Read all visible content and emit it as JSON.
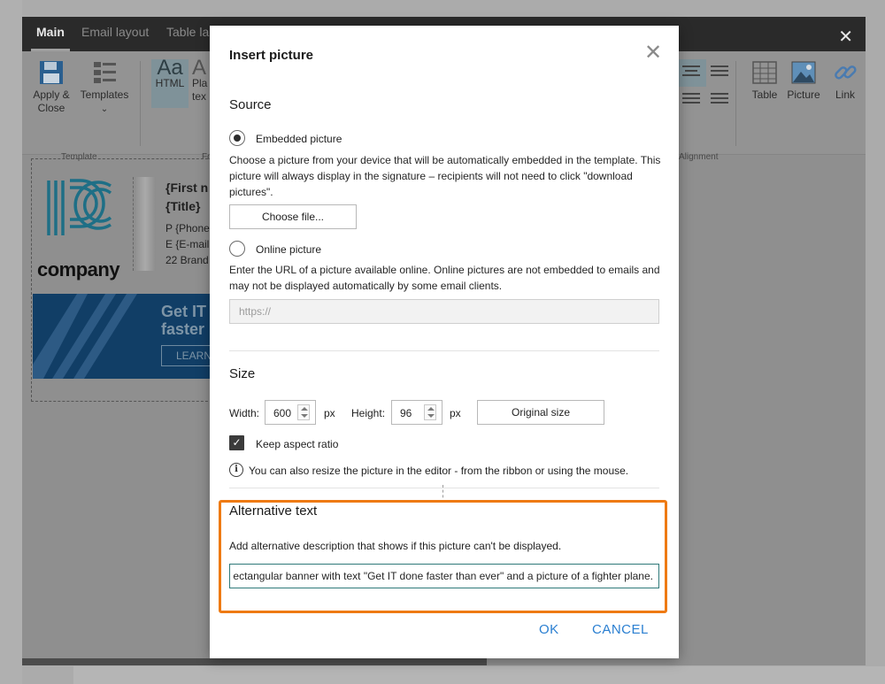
{
  "editor": {
    "tabs": [
      "Main",
      "Email layout",
      "Table la"
    ],
    "close_glyph": "✕",
    "ribbon": {
      "apply_close": "Apply &\nClose",
      "templates": "Templates",
      "templates_caret": "⌄",
      "html": "HTML",
      "plain_text": "Pla\ntex",
      "table": "Table",
      "picture": "Picture",
      "link": "Link",
      "group_template": "Template",
      "group_fo": "Fo",
      "group_alignment": "Alignment"
    },
    "signature": {
      "first_name": "{First n",
      "title": "{Title}",
      "phone": "P {Phone",
      "email": "E {E-mail",
      "address": "22 Brand",
      "company": "company",
      "banner_line1": "Get IT",
      "banner_line2": "faster",
      "banner_button": "LEARN"
    }
  },
  "dialog": {
    "title": "Insert picture",
    "close_glyph": "✕",
    "source": {
      "heading": "Source",
      "embedded_label": "Embedded picture",
      "embedded_selected": true,
      "embedded_desc": "Choose a picture from your device that will be automatically embedded in the template. This picture will always display in the signature – recipients will not need to click \"download pictures\".",
      "choose_file": "Choose file...",
      "online_label": "Online picture",
      "online_selected": false,
      "online_desc": "Enter the URL of a picture available online. Online pictures are not embedded to emails and may not be displayed automatically by some email clients.",
      "url_placeholder": "https://"
    },
    "size": {
      "heading": "Size",
      "width_label": "Width:",
      "width_value": "600",
      "height_label": "Height:",
      "height_value": "96",
      "unit": "px",
      "original_size": "Original size",
      "keep_aspect_label": "Keep aspect ratio",
      "keep_aspect_checked": true,
      "info_text": "You can also resize the picture in the editor - from the ribbon or using the mouse."
    },
    "alt_text": {
      "heading": "Alternative text",
      "desc": "Add alternative description that shows if this picture can't be displayed.",
      "value": "ectangular banner with text \"Get IT done faster than ever\" and a picture of a fighter plane."
    },
    "ok": "OK",
    "cancel": "CANCEL"
  },
  "colors": {
    "accent_highlight": "#ee7a13",
    "link_blue": "#2a7fd1",
    "banner_navy": "#113e66"
  }
}
